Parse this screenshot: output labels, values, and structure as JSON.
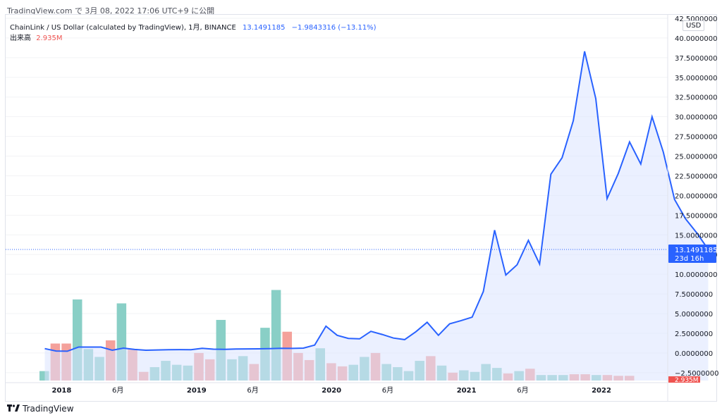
{
  "header": {
    "title": "TradingView.com で 3月 08, 2022 17:06 UTC+9 に公開",
    "usd_button": "USD"
  },
  "legend": {
    "symbol": "ChainLink / US Dollar (calculated by TradingView), 1月, BINANCE",
    "price": "13.1491185",
    "change": "−1.9843316 (−13.11%)",
    "volume_label": "出来高",
    "volume_value": "2.935M"
  },
  "last_price": {
    "label": "13.1491185",
    "countdown": "23d 16h"
  },
  "footer": {
    "logo_text": "TradingView"
  },
  "colors": {
    "line": "#2962ff",
    "area": "#dbe3ff",
    "vol_up": "#89cfc6",
    "vol_down": "#f4a19b",
    "price_badge": "#2962ff",
    "vol_badge": "#ef5350"
  },
  "chart_data": {
    "type": "line",
    "price_axis": {
      "ylim": [
        -3.5,
        42.5
      ],
      "ticks": [
        "−2.5000000",
        "0.0000000",
        "2.5000000",
        "5.0000000",
        "7.5000000",
        "10.0000000",
        "12.5000000",
        "15.0000000",
        "17.5000000",
        "20.0000000",
        "22.5000000",
        "25.0000000",
        "27.5000000",
        "30.0000000",
        "32.5000000",
        "35.0000000",
        "37.5000000",
        "40.0000000",
        "42.5000000"
      ]
    },
    "time_axis": {
      "labels": [
        {
          "text": "2018",
          "bold": true,
          "index": 1.5
        },
        {
          "text": "6月",
          "bold": false,
          "index": 6.5
        },
        {
          "text": "2019",
          "bold": true,
          "index": 13.5
        },
        {
          "text": "6月",
          "bold": false,
          "index": 18.5
        },
        {
          "text": "2020",
          "bold": true,
          "index": 25.5
        },
        {
          "text": "6月",
          "bold": false,
          "index": 30.5
        },
        {
          "text": "2021",
          "bold": true,
          "index": 37.5
        },
        {
          "text": "6月",
          "bold": false,
          "index": 42.5
        },
        {
          "text": "2022",
          "bold": true,
          "index": 49.5
        }
      ]
    },
    "series": [
      {
        "values": [
          0.55,
          0.25,
          0.22,
          0.75,
          0.75,
          0.75,
          0.35,
          0.62,
          0.45,
          0.35,
          0.38,
          0.42,
          0.43,
          0.42,
          0.6,
          0.48,
          0.46,
          0.5,
          0.52,
          0.53,
          0.55,
          0.6,
          0.58,
          0.62,
          1.0,
          3.4,
          2.25,
          1.85,
          1.8,
          2.75,
          2.35,
          1.9,
          1.7,
          2.7,
          3.9,
          2.25,
          3.7,
          4.1,
          4.55,
          7.8,
          15.6,
          9.9,
          11.2,
          14.3,
          11.3,
          22.7,
          24.8,
          29.5,
          38.3,
          32.3,
          19.6,
          22.8,
          26.8,
          24.0,
          30.0,
          25.5,
          19.5,
          17.0,
          15.2,
          13.15
        ]
      }
    ],
    "volume": {
      "values": [
        -2.3,
        1.2,
        1.2,
        6.8,
        0.5,
        -0.5,
        1.6,
        6.3,
        0.5,
        -2.4,
        -1.8,
        -1.0,
        -1.5,
        -1.6,
        0.0,
        -0.8,
        4.2,
        -0.8,
        -0.4,
        -1.4,
        3.2,
        8.0,
        2.7,
        0.0,
        -0.9,
        0.6,
        -1.3,
        -1.7,
        -1.5,
        -0.5,
        0.0,
        -1.4,
        -1.8,
        -2.3,
        -1.0,
        -0.4,
        -1.6,
        -2.5,
        -2.2,
        -2.4,
        -1.4,
        -1.9,
        -2.6,
        -2.3,
        -2.0,
        -2.8,
        -2.8,
        -2.8,
        -2.7,
        -2.7,
        -2.8,
        -2.8,
        -2.9,
        -2.9
      ],
      "up": [
        true,
        false,
        false,
        true,
        true,
        true,
        false,
        true,
        false,
        false,
        true,
        true,
        true,
        true,
        false,
        false,
        true,
        true,
        true,
        false,
        true,
        true,
        false,
        false,
        false,
        true,
        false,
        false,
        true,
        true,
        false,
        true,
        true,
        true,
        true,
        false,
        true,
        false,
        true,
        true,
        true,
        true,
        false,
        true,
        false,
        true,
        true,
        true,
        false,
        false,
        true,
        false,
        false,
        false
      ]
    }
  }
}
